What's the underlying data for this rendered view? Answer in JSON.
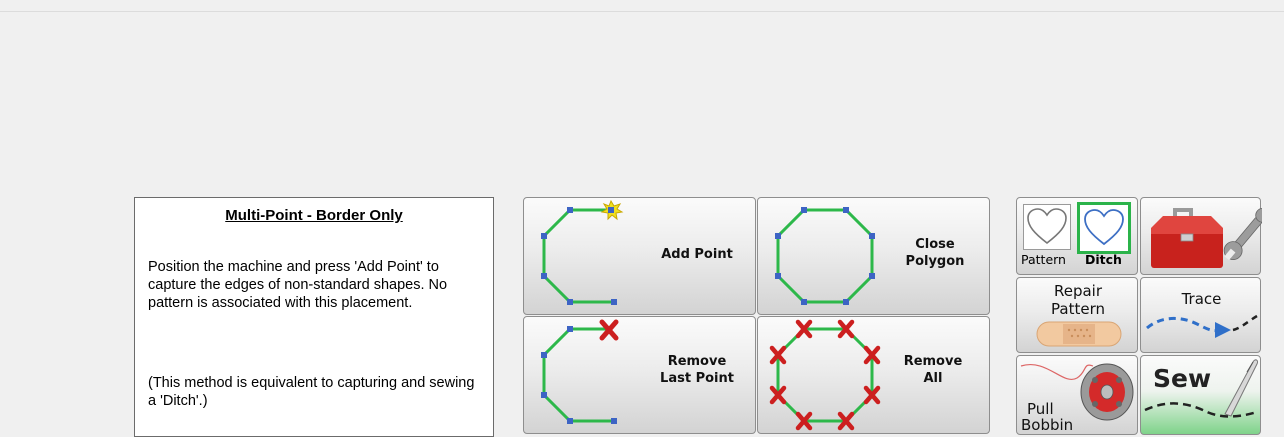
{
  "info_panel": {
    "title": "Multi-Point - Border Only",
    "paragraph1": "Position the machine and press 'Add Point' to capture the edges of non-standard shapes. No pattern is associated with this placement.",
    "paragraph2": "(This method is equivalent to capturing and sewing a 'Ditch'.)"
  },
  "point_buttons": {
    "add_point": "Add Point",
    "close_polygon_line1": "Close",
    "close_polygon_line2": "Polygon",
    "remove_last_line1": "Remove",
    "remove_last_line2": "Last Point",
    "remove_all_line1": "Remove",
    "remove_all_line2": "All"
  },
  "side_buttons": {
    "pattern": "Pattern",
    "ditch": "Ditch",
    "repair_line1": "Repair",
    "repair_line2": "Pattern",
    "trace": "Trace",
    "pull_line1": "Pull",
    "pull_line2": "Bobbin",
    "sew": "Sew"
  },
  "icons": {
    "add_point": "open-polygon-new-point-icon",
    "close_polygon": "octagon-icon",
    "remove_last_point": "polygon-x-last-icon",
    "remove_all": "octagon-all-x-icon",
    "pattern": "heart-outline-icon",
    "ditch": "heart-outline-blue-icon",
    "toolbox": "toolbox-wrench-icon",
    "repair": "bandage-icon",
    "trace": "dashed-arrow-icon",
    "bobbin": "bobbin-thread-icon",
    "sew": "needle-stitch-icon"
  },
  "colors": {
    "line": "#2db84a",
    "point": "#3d64c4",
    "x_mark": "#cc1f1f",
    "ditch_border": "#2bb34a",
    "sew_green": "#7fd38a"
  }
}
